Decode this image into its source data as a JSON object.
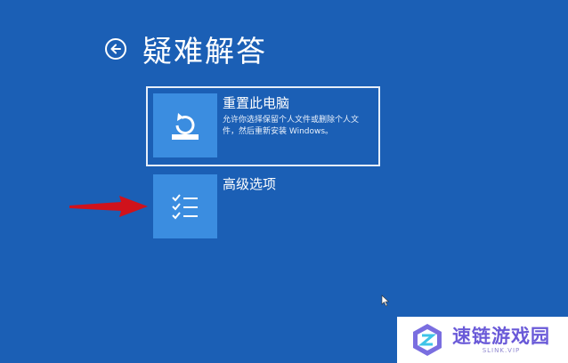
{
  "header": {
    "title": "疑难解答"
  },
  "options": [
    {
      "title": "重置此电脑",
      "description": "允许你选择保留个人文件或删除个人文件，然后重新安装 Windows。"
    },
    {
      "title": "高级选项"
    }
  ],
  "watermark": {
    "name": "速链游戏园",
    "sub": "SLINK.VIP"
  },
  "colors": {
    "background": "#1b5fb5",
    "tile": "#3b8de0",
    "arrow": "#d0121b",
    "watermark_text": "#6a5ad8"
  }
}
